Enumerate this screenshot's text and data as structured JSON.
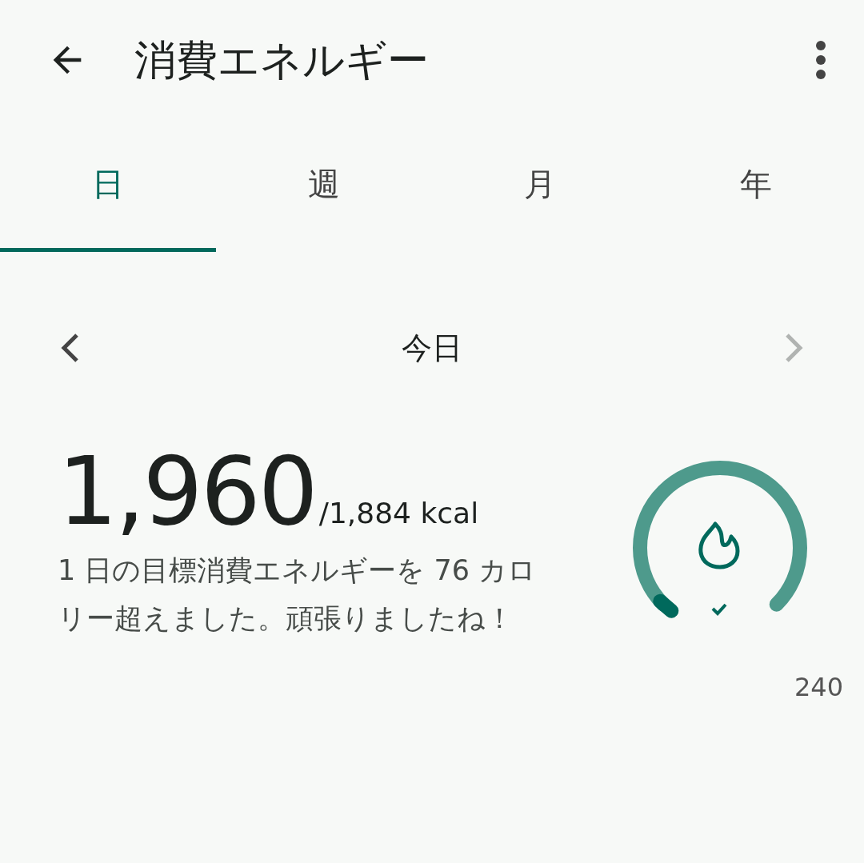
{
  "app_bar": {
    "title": "消費エネルギー"
  },
  "tabs": [
    {
      "label": "日",
      "selected": true
    },
    {
      "label": "週",
      "selected": false
    },
    {
      "label": "月",
      "selected": false
    },
    {
      "label": "年",
      "selected": false
    }
  ],
  "date_nav": {
    "label": "今日",
    "prev_disabled": false,
    "next_disabled": true
  },
  "summary": {
    "value": "1,960",
    "goal": "/1,884 kcal",
    "message": "1 日の目標消費エネルギーを 76 カロリー超えました。頑張りましたね！"
  },
  "gauge": {
    "goal_met": true
  },
  "axis_label": "240"
}
